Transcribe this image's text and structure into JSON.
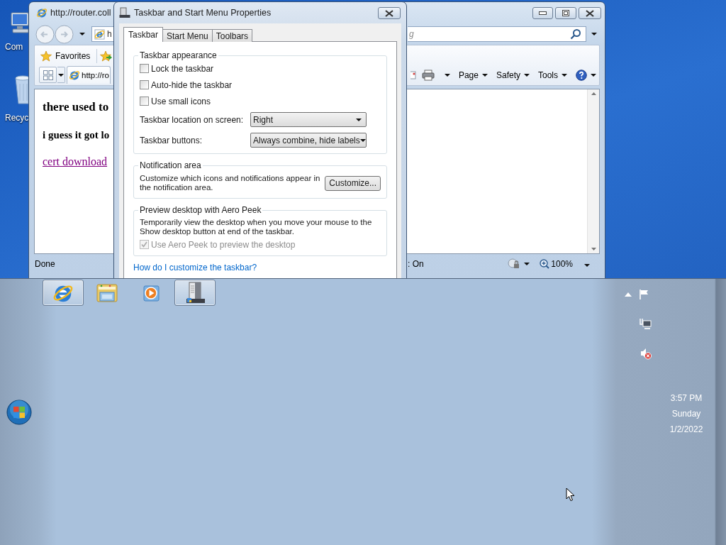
{
  "desktop_icons": [
    {
      "kind": "computer",
      "label": "Com"
    },
    {
      "kind": "recycle_bin",
      "label": "Recyc"
    }
  ],
  "browser": {
    "title": "http://router.coll",
    "address": "h",
    "search": {
      "placeholder": "g"
    },
    "favorites": "Favorites",
    "tab": "http://ro",
    "commands": [
      "Page",
      "Safety",
      "Tools"
    ],
    "content": [
      {
        "kind": "heading",
        "text": "there used to"
      },
      {
        "kind": "subheading",
        "text": "i guess it got lo"
      },
      {
        "kind": "link",
        "text": "cert download"
      }
    ],
    "status": "Done",
    "status_zone": ": On",
    "zoom": "100%"
  },
  "dialog": {
    "title": "Taskbar and Start Menu Properties",
    "tabs": [
      {
        "label": "Taskbar",
        "selected": true
      },
      {
        "label": "Start Menu",
        "selected": false
      },
      {
        "label": "Toolbars",
        "selected": false
      }
    ],
    "groups": [
      {
        "legend": "Taskbar appearance",
        "checkboxes": [
          {
            "label": "Lock the taskbar",
            "checked": false,
            "disabled": false
          },
          {
            "label": "Auto-hide the taskbar",
            "checked": false,
            "disabled": false
          },
          {
            "label": "Use small icons",
            "checked": false,
            "disabled": false
          }
        ],
        "selects": [
          {
            "label": "Taskbar location on screen:",
            "value": "Right"
          },
          {
            "label": "Taskbar buttons:",
            "value": "Always combine, hide labels"
          }
        ]
      },
      {
        "legend": "Notification area",
        "text": "Customize which icons and notifications appear in the notification area.",
        "button": "Customize..."
      },
      {
        "legend": "Preview desktop with Aero Peek",
        "text": "Temporarily view the desktop when you move your mouse to the Show desktop button at end of the taskbar.",
        "checkboxes": [
          {
            "label": "Use Aero Peek to preview the desktop",
            "checked": true,
            "disabled": true
          }
        ]
      }
    ],
    "help_link": "How do I customize the taskbar?"
  },
  "taskbar": {
    "buttons": [
      {
        "kind": "browser",
        "running": true
      },
      {
        "kind": "folder",
        "running": false
      },
      {
        "kind": "media",
        "running": false
      },
      {
        "kind": "server",
        "running": true
      }
    ],
    "clock": {
      "time": "3:57 PM",
      "day": "Sunday",
      "date": "1/2/2022"
    }
  }
}
